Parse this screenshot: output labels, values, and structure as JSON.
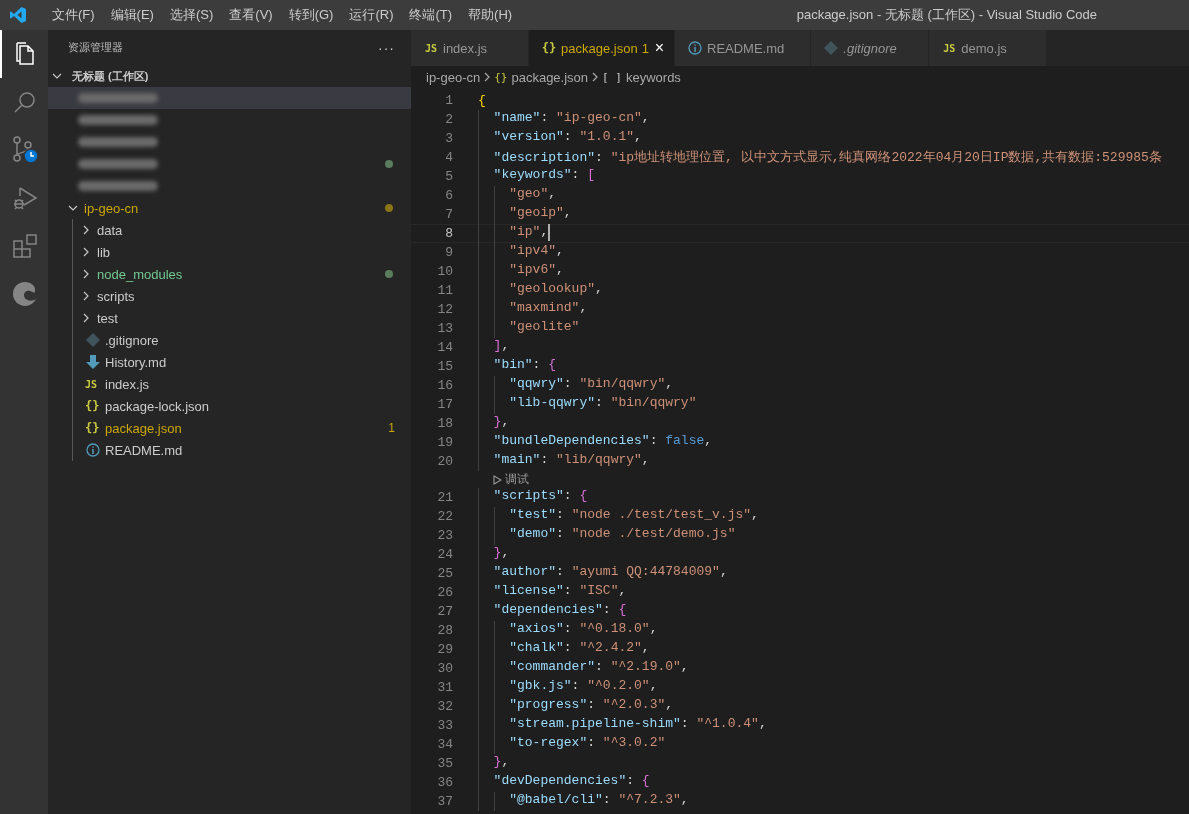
{
  "window": {
    "title": "package.json - 无标题 (工作区) - Visual Studio Code"
  },
  "menu": [
    "文件(F)",
    "编辑(E)",
    "选择(S)",
    "查看(V)",
    "转到(G)",
    "运行(R)",
    "终端(T)",
    "帮助(H)"
  ],
  "activity_bar": [
    {
      "kind": "files",
      "selected": true
    },
    {
      "kind": "search",
      "selected": false
    },
    {
      "kind": "source-control",
      "selected": false
    },
    {
      "kind": "debug",
      "selected": false
    },
    {
      "kind": "extensions",
      "selected": false
    },
    {
      "kind": "edge",
      "selected": false
    }
  ],
  "sidebar": {
    "title": "资源管理器",
    "more": "···",
    "workspace": {
      "label": "无标题 (工作区)",
      "expanded": true
    },
    "items": [
      {
        "kind": "redacted",
        "selected": true
      },
      {
        "kind": "redacted",
        "selected": false
      },
      {
        "kind": "redacted",
        "selected": false
      },
      {
        "kind": "redacted",
        "selected": false,
        "status": {
          "color": "#587c5c"
        }
      },
      {
        "kind": "redacted",
        "selected": false
      },
      {
        "kind": "folder",
        "label": "ip-geo-cn",
        "expanded": true,
        "selected": false,
        "color": "#cca700",
        "status": {
          "color": "#8a7413"
        },
        "children": [
          {
            "kind": "folder",
            "label": "data",
            "expanded": false,
            "selected": false,
            "color": "#cccccc"
          },
          {
            "kind": "folder",
            "label": "lib",
            "expanded": false,
            "selected": false,
            "color": "#cccccc"
          },
          {
            "kind": "folder",
            "label": "node_modules",
            "expanded": false,
            "selected": false,
            "color": "#73c991",
            "status": {
              "color": "#587c5c"
            }
          },
          {
            "kind": "folder",
            "label": "scripts",
            "expanded": false,
            "selected": false,
            "color": "#cccccc"
          },
          {
            "kind": "folder",
            "label": "test",
            "expanded": false,
            "selected": false,
            "color": "#cccccc"
          },
          {
            "kind": "gitfile",
            "label": ".gitignore",
            "selected": false,
            "color": "#cccccc"
          },
          {
            "kind": "mdfile",
            "label": "History.md",
            "selected": false,
            "color": "#cccccc"
          },
          {
            "kind": "jsfile",
            "icon_text": "JS",
            "label": "index.js",
            "selected": false,
            "color": "#cccccc"
          },
          {
            "kind": "jsonfile",
            "icon_text": "{}",
            "label": "package-lock.json",
            "selected": false,
            "color": "#cccccc"
          },
          {
            "kind": "jsonfile",
            "icon_text": "{}",
            "label": "package.json",
            "selected": false,
            "color": "#cca700",
            "badge": "1"
          },
          {
            "kind": "infofile",
            "label": "README.md",
            "selected": false,
            "color": "#cccccc"
          }
        ]
      }
    ]
  },
  "tabs": [
    {
      "kind": "jsfile",
      "icon_text": "JS",
      "label": "index.js",
      "selected": false
    },
    {
      "kind": "jsonfile",
      "icon_text": "{}",
      "label": "package.json",
      "badge": "1",
      "close": "×",
      "selected": true
    },
    {
      "kind": "infofile",
      "label": "README.md",
      "selected": false
    },
    {
      "kind": "gitfile",
      "label": ".gitignore",
      "preview": true,
      "selected": false
    },
    {
      "kind": "jsfile",
      "icon_text": "JS",
      "label": "demo.js",
      "selected": false
    }
  ],
  "breadcrumb": [
    {
      "label": "ip-geo-cn"
    },
    {
      "icon_text": "{}",
      "label": "package.json"
    },
    {
      "icon_text": "[ ]",
      "label": "keywords"
    }
  ],
  "editor": {
    "lines": [
      {
        "kind": "code",
        "n": "1",
        "text": "{",
        "current": false
      },
      {
        "kind": "code",
        "n": "2",
        "text": "  \"name\": \"ip-geo-cn\",",
        "current": false
      },
      {
        "kind": "code",
        "n": "3",
        "text": "  \"version\": \"1.0.1\",",
        "current": false
      },
      {
        "kind": "code",
        "n": "4",
        "text": "  \"description\": \"ip地址转地理位置, 以中文方式显示,纯真网络2022年04月20日IP数据,共有数据:529985条",
        "current": false
      },
      {
        "kind": "code",
        "n": "5",
        "text": "  \"keywords\": [",
        "current": false
      },
      {
        "kind": "code",
        "n": "6",
        "text": "    \"geo\",",
        "current": false
      },
      {
        "kind": "code",
        "n": "7",
        "text": "    \"geoip\",",
        "current": false
      },
      {
        "kind": "code",
        "n": "8",
        "text": "    \"ip\",",
        "current": true
      },
      {
        "kind": "code",
        "n": "9",
        "text": "    \"ipv4\",",
        "current": false
      },
      {
        "kind": "code",
        "n": "10",
        "text": "    \"ipv6\",",
        "current": false
      },
      {
        "kind": "code",
        "n": "11",
        "text": "    \"geolookup\",",
        "current": false
      },
      {
        "kind": "code",
        "n": "12",
        "text": "    \"maxmind\",",
        "current": false
      },
      {
        "kind": "code",
        "n": "13",
        "text": "    \"geolite\"",
        "current": false
      },
      {
        "kind": "code",
        "n": "14",
        "text": "  ],",
        "current": false
      },
      {
        "kind": "code",
        "n": "15",
        "text": "  \"bin\": {",
        "current": false
      },
      {
        "kind": "code",
        "n": "16",
        "text": "    \"qqwry\": \"bin/qqwry\",",
        "current": false
      },
      {
        "kind": "code",
        "n": "17",
        "text": "    \"lib-qqwry\": \"bin/qqwry\"",
        "current": false
      },
      {
        "kind": "code",
        "n": "18",
        "text": "  },",
        "current": false
      },
      {
        "kind": "code",
        "n": "19",
        "text": "  \"bundleDependencies\": false,",
        "current": false
      },
      {
        "kind": "code",
        "n": "20",
        "text": "  \"main\": \"lib/qqwry\",",
        "current": false
      },
      {
        "kind": "codelens",
        "text": "调试"
      },
      {
        "kind": "code",
        "n": "21",
        "text": "  \"scripts\": {",
        "current": false
      },
      {
        "kind": "code",
        "n": "22",
        "text": "    \"test\": \"node ./test/test_v.js\",",
        "current": false
      },
      {
        "kind": "code",
        "n": "23",
        "text": "    \"demo\": \"node ./test/demo.js\"",
        "current": false
      },
      {
        "kind": "code",
        "n": "24",
        "text": "  },",
        "current": false
      },
      {
        "kind": "code",
        "n": "25",
        "text": "  \"author\": \"ayumi QQ:44784009\",",
        "current": false
      },
      {
        "kind": "code",
        "n": "26",
        "text": "  \"license\": \"ISC\",",
        "current": false
      },
      {
        "kind": "code",
        "n": "27",
        "text": "  \"dependencies\": {",
        "current": false
      },
      {
        "kind": "code",
        "n": "28",
        "text": "    \"axios\": \"^0.18.0\",",
        "current": false
      },
      {
        "kind": "code",
        "n": "29",
        "text": "    \"chalk\": \"^2.4.2\",",
        "current": false
      },
      {
        "kind": "code",
        "n": "30",
        "text": "    \"commander\": \"^2.19.0\",",
        "current": false
      },
      {
        "kind": "code",
        "n": "31",
        "text": "    \"gbk.js\": \"^0.2.0\",",
        "current": false
      },
      {
        "kind": "code",
        "n": "32",
        "text": "    \"progress\": \"^2.0.3\",",
        "current": false
      },
      {
        "kind": "code",
        "n": "33",
        "text": "    \"stream.pipeline-shim\": \"^1.0.4\",",
        "current": false
      },
      {
        "kind": "code",
        "n": "34",
        "text": "    \"to-regex\": \"^3.0.2\"",
        "current": false
      },
      {
        "kind": "code",
        "n": "35",
        "text": "  },",
        "current": false
      },
      {
        "kind": "code",
        "n": "36",
        "text": "  \"devDependencies\": {",
        "current": false
      },
      {
        "kind": "code",
        "n": "37",
        "text": "    \"@babel/cli\": \"^7.2.3\",",
        "current": false
      }
    ]
  }
}
